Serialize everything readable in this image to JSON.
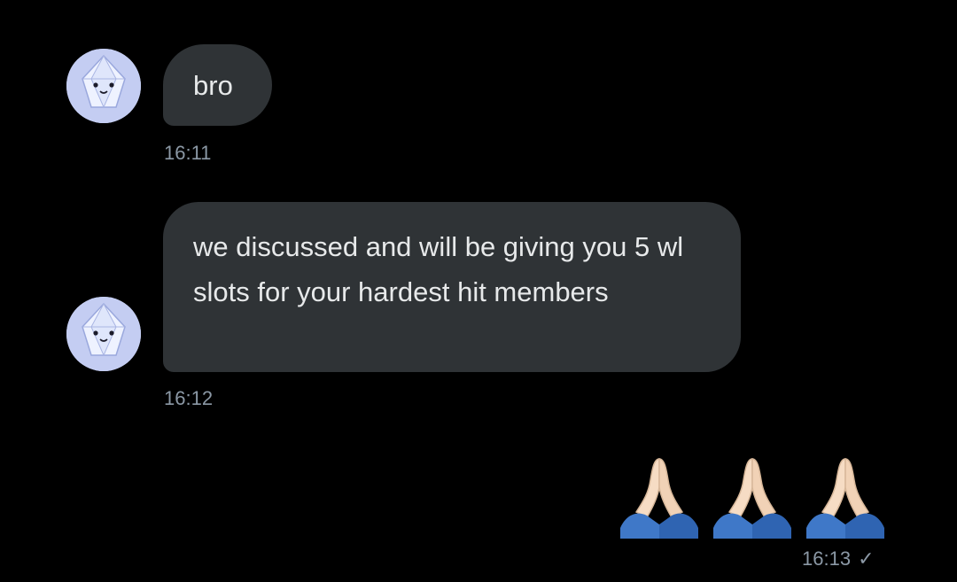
{
  "conversation": {
    "messages": [
      {
        "direction": "incoming",
        "avatar_icon": "diamond-mascot-icon",
        "text": "bro",
        "timestamp": "16:11"
      },
      {
        "direction": "incoming",
        "avatar_icon": "diamond-mascot-icon",
        "text": "we discussed and will be giving you 5 wl slots for your hardest hit members",
        "timestamp": "16:12"
      },
      {
        "direction": "outgoing",
        "emoji": [
          "🙏",
          "🙏",
          "🙏"
        ],
        "emoji_icon": "folded-hands-icon",
        "timestamp": "16:13",
        "status_icon": "sent-check-icon",
        "status_glyph": "✓"
      }
    ]
  },
  "colors": {
    "background": "#000000",
    "incoming_bubble": "#2f3336",
    "text": "#e7e9ea",
    "timestamp": "#8b98a5",
    "avatar_bg": "#c9d3f6"
  }
}
